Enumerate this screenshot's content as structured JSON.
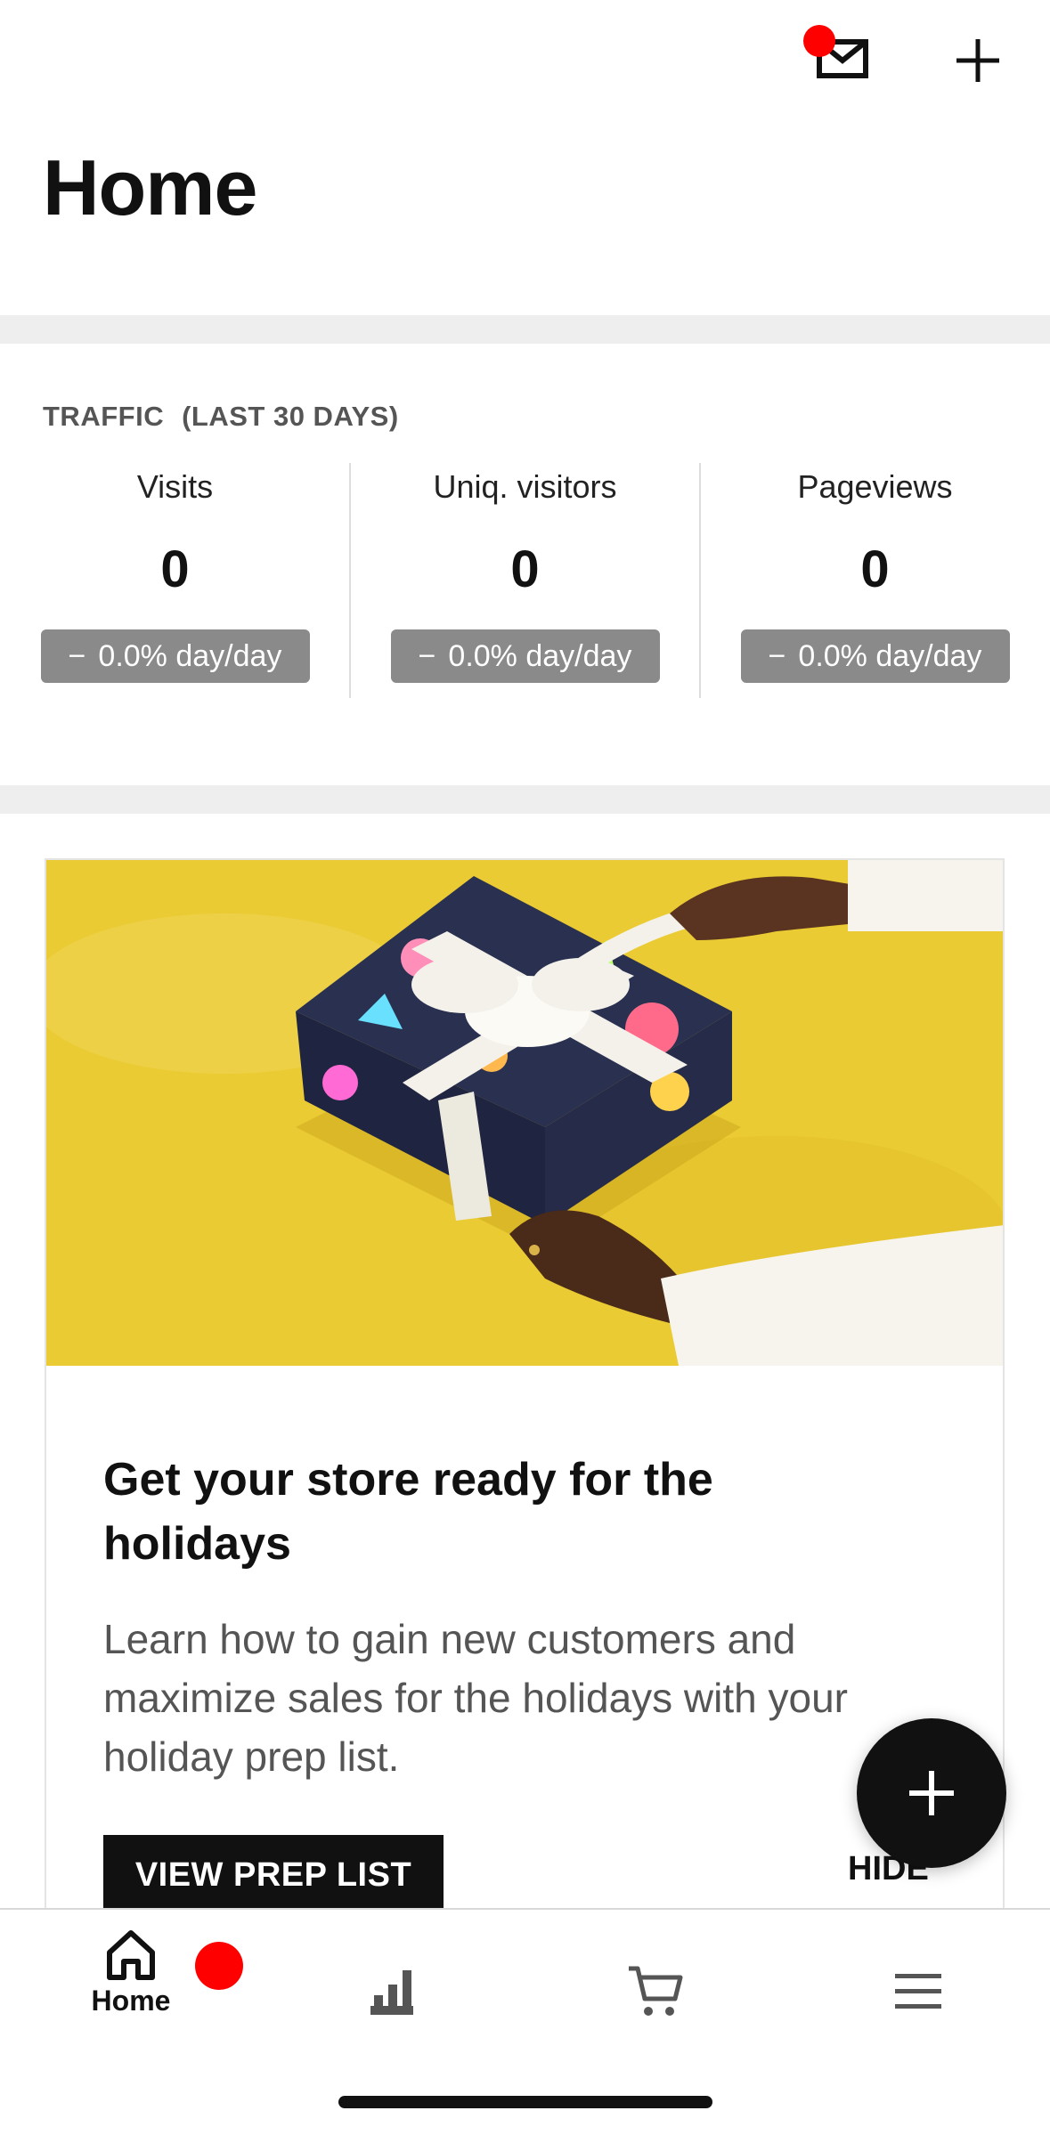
{
  "header": {
    "title": "Home",
    "icons": {
      "inbox": "mail-icon",
      "add": "plus-icon"
    },
    "badge_color": "#ff0000"
  },
  "traffic": {
    "label": "TRAFFIC",
    "period": "(LAST 30 DAYS)",
    "stats": [
      {
        "name": "Visits",
        "value": "0",
        "change": "0.0% day/day"
      },
      {
        "name": "Uniq. visitors",
        "value": "0",
        "change": "0.0% day/day"
      },
      {
        "name": "Pageviews",
        "value": "0",
        "change": "0.0% day/day"
      }
    ]
  },
  "promo": {
    "title": "Get your store ready for the holidays",
    "body": "Learn how to gain new customers and maximize sales for the holidays with your holiday prep list.",
    "cta": "VIEW PREP LIST",
    "dismiss": "HIDE"
  },
  "tabs": [
    {
      "label": "Home",
      "icon": "home-icon",
      "active": true,
      "badge": true
    },
    {
      "label": "",
      "icon": "stats-icon",
      "active": false
    },
    {
      "label": "",
      "icon": "cart-icon",
      "active": false
    },
    {
      "label": "",
      "icon": "menu-icon",
      "active": false
    }
  ],
  "colors": {
    "accent": "#111111",
    "badge": "#ff0000",
    "pill": "#8a8a8a",
    "band": "#eeeeee",
    "banner": "#eacb33"
  }
}
